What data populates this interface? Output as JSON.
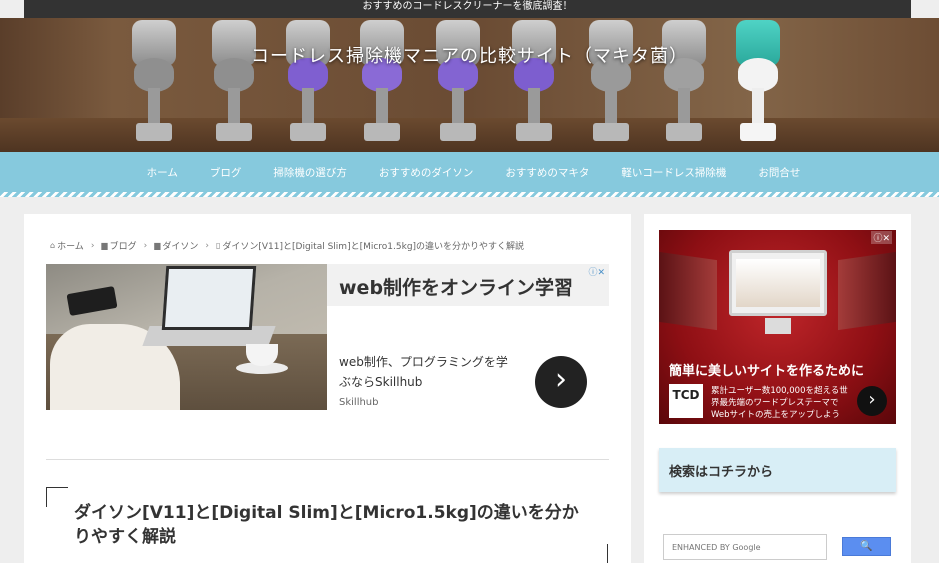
{
  "topbar": {
    "text": "おすすめのコードレスクリーナーを徹底調査！"
  },
  "header": {
    "site_title": "コードレス掃除機マニアの比較サイト（マキタ菌）"
  },
  "nav": {
    "items": [
      {
        "label": "ホーム"
      },
      {
        "label": "ブログ"
      },
      {
        "label": "掃除機の選び方"
      },
      {
        "label": "おすすめのダイソン"
      },
      {
        "label": "おすすめのマキタ"
      },
      {
        "label": "軽いコードレス掃除機"
      },
      {
        "label": "お問合せ"
      }
    ]
  },
  "breadcrumb": {
    "items": [
      {
        "label": "ホーム",
        "icon": "home-icon"
      },
      {
        "label": "ブログ",
        "icon": "folder-icon"
      },
      {
        "label": "ダイソン",
        "icon": "folder-icon"
      },
      {
        "label": "ダイソン[V11]と[Digital Slim]と[Micro1.5kg]の違いを分かりやすく解説",
        "icon": "file-icon"
      }
    ],
    "separator": "›"
  },
  "main_ad": {
    "headline": "web制作をオンライン学習",
    "description": "web制作、プログラミングを学ぶならSkillhub",
    "source": "Skillhub",
    "arrow": "›",
    "choice_icon": "ⓘ✕"
  },
  "article": {
    "title": "ダイソン[V11]と[Digital Slim]と[Micro1.5kg]の違いを分かりやすく解説"
  },
  "side_ad": {
    "headline": "簡単に美しいサイトを作るために",
    "logo": "TCD",
    "description": "累計ユーザー数100,000を超える世界最先端のワードプレステーマでWebサイトの売上をアップしよう",
    "arrow": "›",
    "choice_icon": "ⓘ✕"
  },
  "search_widget": {
    "heading": "検索はコチラから",
    "placeholder": "ENHANCED BY Google",
    "button_icon": "🔍"
  },
  "colors": {
    "nav_bg": "#86c9dd",
    "widget_bg": "#d8eef6",
    "search_button": "#5b8ef0",
    "topbar_bg": "#333333"
  }
}
